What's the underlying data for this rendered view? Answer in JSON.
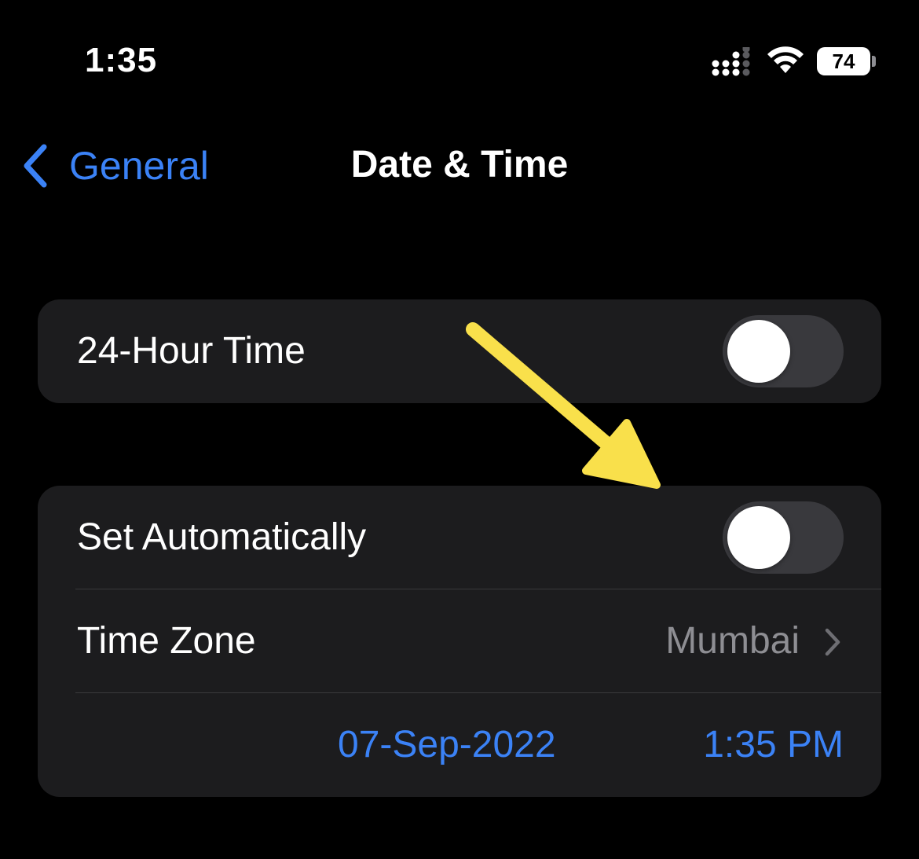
{
  "status_bar": {
    "time": "1:35",
    "battery_level": "74",
    "icons": [
      "cellular-signal-icon",
      "wifi-icon",
      "battery-icon"
    ]
  },
  "nav": {
    "back_label": "General",
    "title": "Date & Time"
  },
  "settings": {
    "hour24": {
      "label": "24-Hour Time",
      "enabled": false
    },
    "set_automatically": {
      "label": "Set Automatically",
      "enabled": false
    },
    "time_zone": {
      "label": "Time Zone",
      "value": "Mumbai"
    },
    "date": "07-Sep-2022",
    "time": "1:35 PM"
  },
  "annotation": {
    "type": "arrow",
    "color": "#f9e04b",
    "points_to": "set-automatically-toggle"
  },
  "colors": {
    "background": "#000000",
    "group_background": "#1c1c1e",
    "accent": "#3b82f6",
    "secondary_text": "#8e8e93",
    "toggle_off": "#39393d"
  }
}
